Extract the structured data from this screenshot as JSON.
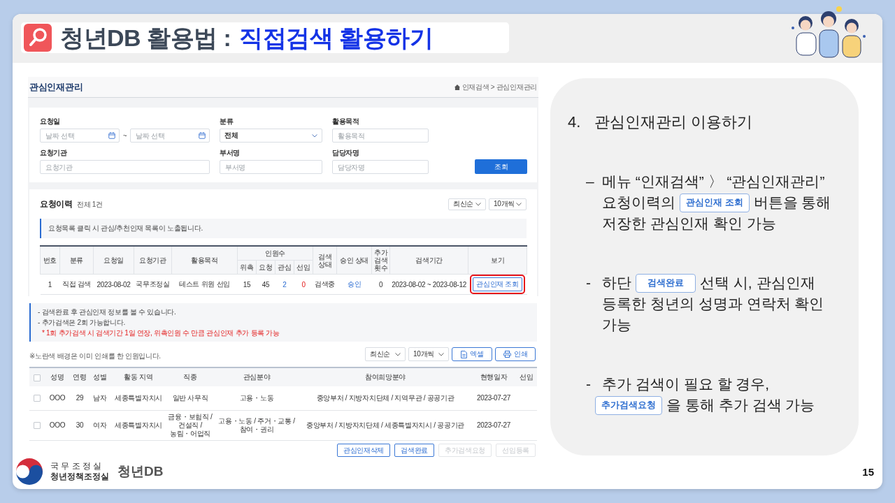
{
  "slide": {
    "title_lead": "청년DB 활용법 :",
    "title_highlight": "직접검색 활용하기"
  },
  "screenshot": {
    "page_title": "관심인재관리",
    "breadcrumb": "인재검색 > 관심인재관리",
    "search_form": {
      "fields": [
        {
          "kind": "date_range",
          "label": "요청일",
          "placeholders": [
            "날짜 선택",
            "날짜 선택"
          ],
          "separator": "~"
        },
        {
          "kind": "select",
          "label": "분류",
          "value": "전체"
        },
        {
          "kind": "text",
          "label": "활용목적",
          "placeholder": "활용목적"
        },
        {
          "kind": "text",
          "label": "요청기관",
          "placeholder": "요청기관"
        },
        {
          "kind": "text",
          "label": "부서명",
          "placeholder": "부서명"
        },
        {
          "kind": "text",
          "label": "담당자명",
          "placeholder": "담당자명"
        }
      ],
      "submit": "조회"
    },
    "history": {
      "title": "요청이력",
      "count": "전체 1건",
      "sort": "최신순",
      "page_size": "10개씩",
      "info": "요청목록 클릭 시 관심/추천인재 목록이 노출됩니다.",
      "header_rows": [
        [
          {
            "label": "번호",
            "rowspan": 2
          },
          {
            "label": "분류",
            "rowspan": 2
          },
          {
            "label": "요청일",
            "rowspan": 2
          },
          {
            "label": "요청기관",
            "rowspan": 2
          },
          {
            "label": "활용목적",
            "rowspan": 2
          },
          {
            "label": "인원수",
            "colspan": 4
          },
          {
            "label": "검색 상태",
            "rowspan": 2
          },
          {
            "label": "승인 상태",
            "rowspan": 2
          },
          {
            "label": "추가 검색 횟수",
            "rowspan": 2
          },
          {
            "label": "검색기간",
            "rowspan": 2
          },
          {
            "label": "보기",
            "rowspan": 2
          }
        ],
        [
          {
            "label": "위촉"
          },
          {
            "label": "요청"
          },
          {
            "label": "관심"
          },
          {
            "label": "선임"
          }
        ]
      ],
      "rows": [
        {
          "cells": [
            "1",
            "직접 검색",
            "2023-08-02",
            "국무조정실",
            "테스트 위원 선임",
            "15",
            "45",
            "2",
            "0",
            "검색중",
            "승인",
            "0",
            "2023-08-02 ~ 2023-08-12"
          ],
          "view_button": {
            "label": "관심인재 조회",
            "highlighted": true
          }
        }
      ]
    },
    "notes": [
      {
        "kind": "info",
        "text": "- 검색완료 후 관심인재 정보를 볼 수 있습니다."
      },
      {
        "kind": "info",
        "text": "- 추가검색은 2회 가능합니다."
      },
      {
        "kind": "warning",
        "text": "* 1회 추가검색 시 검색기간 1일 연장, 위촉인원 수 만큼 관심인재 추가 등록 가능"
      }
    ],
    "results": {
      "legend": "※노란색 배경은 이미 인쇄를 한 인원입니다.",
      "sort": "최신순",
      "page_size": "10개씩",
      "tools": [
        {
          "kind": "excel",
          "label": "엑셀"
        },
        {
          "kind": "print",
          "label": "인쇄"
        }
      ],
      "select_all_checked": false,
      "columns": [
        "성명",
        "연령",
        "성별",
        "활동 지역",
        "직종",
        "관심분야",
        "참여희망분야",
        "현행일자",
        "선임"
      ],
      "rows": [
        {
          "checked": false,
          "cells": [
            "OOO",
            "29",
            "남자",
            "세종특별자치시",
            "일반 사무직",
            "고용・노동",
            "중앙부처 / 지방자치단체 / 지역무관 / 공공기관",
            "2023-07-27"
          ]
        },
        {
          "checked": false,
          "cells": [
            "OOO",
            "30",
            "여자",
            "세종특별자치시",
            "금융・보험직 / 건설직 / 농림・어업직",
            "고용・노동 / 주거・교통 / 참여・권리",
            "중앙부처 / 지방자치단체 / 세종특별자치시 / 공공기관",
            "2023-07-27"
          ]
        }
      ],
      "buttons": [
        {
          "label": "관심인재삭제",
          "disabled": false
        },
        {
          "label": "검색완료",
          "disabled": false
        },
        {
          "label": "추가검색요청",
          "disabled": true
        },
        {
          "label": "선임등록",
          "disabled": true
        }
      ]
    }
  },
  "guide": {
    "number": "4.",
    "heading": "관심인재관리 이용하기",
    "bullets": [
      {
        "marker": "–",
        "lines": [
          [
            {
              "kind": "text",
              "text": "메뉴 “인재검색” 〉 “관심인재관리”"
            }
          ],
          [
            {
              "kind": "text",
              "text": "요청이력의"
            },
            {
              "kind": "button",
              "text": "관심인재 조회"
            },
            {
              "kind": "text",
              "text": "버튼을 통해"
            }
          ],
          [
            {
              "kind": "text",
              "text": "저장한 관심인재 확인 가능"
            }
          ]
        ]
      },
      {
        "marker": "-",
        "lines": [
          [
            {
              "kind": "text",
              "text": "하단"
            },
            {
              "kind": "button",
              "text": "검색완료"
            },
            {
              "kind": "text",
              "text": "선택 시, 관심인재"
            }
          ],
          [
            {
              "kind": "text",
              "text": "등록한 청년의 성명과 연락처 확인"
            }
          ],
          [
            {
              "kind": "text",
              "text": "가능"
            }
          ]
        ]
      },
      {
        "marker": "-",
        "lines": [
          [
            {
              "kind": "text",
              "text": "추가 검색이 필요 할 경우,"
            }
          ],
          [
            {
              "kind": "button",
              "text": "추가검색요청"
            },
            {
              "kind": "text",
              "text": "을 통해 추가 검색 가능"
            }
          ]
        ]
      }
    ]
  },
  "footer": {
    "org_name": "국 무 조 정 실",
    "org_unit": "청년정책조정실",
    "brand": "청년DB",
    "page_number": "15"
  }
}
